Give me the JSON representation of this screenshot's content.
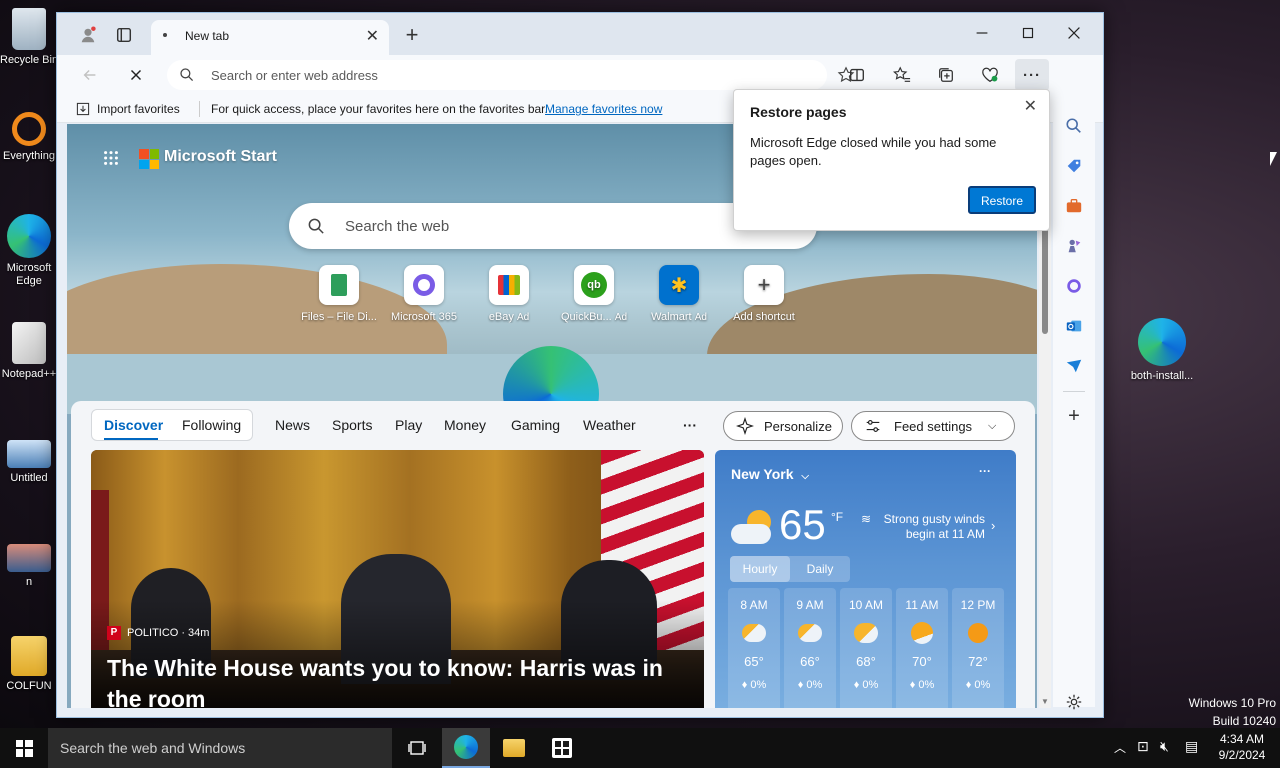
{
  "desktop": {
    "left_icons": [
      {
        "label": "Recycle Bin"
      },
      {
        "label": "Everything"
      },
      {
        "label": "Microsoft Edge"
      },
      {
        "label": "Notepad++"
      },
      {
        "label": "Untitled"
      },
      {
        "label": "n"
      },
      {
        "label": "COLFUN"
      }
    ],
    "right_icon": {
      "label": "both-install..."
    },
    "watermark_line1": "Windows 10 Pro",
    "watermark_line2": "Build 10240"
  },
  "browser": {
    "tab_title": "New tab",
    "address_placeholder": "Search or enter web address",
    "favbar": {
      "import_label": "Import favorites",
      "hint": "For quick access, place your favorites here on the favorites bar.",
      "manage_link": "Manage favorites now"
    },
    "popup": {
      "title": "Restore pages",
      "message": "Microsoft Edge closed while you had some pages open.",
      "button": "Restore"
    }
  },
  "newtab": {
    "brand": "Microsoft Start",
    "search_placeholder": "Search the web",
    "shortcuts": [
      {
        "label": "Files – File Di..."
      },
      {
        "label": "Microsoft 365"
      },
      {
        "label": "eBay",
        "ad": "Ad"
      },
      {
        "label": "QuickBu...",
        "ad": "Ad"
      },
      {
        "label": "Walmart",
        "ad": "Ad"
      },
      {
        "label": "Add shortcut"
      }
    ],
    "nav": {
      "tabs": [
        "Discover",
        "Following"
      ],
      "categories": [
        "News",
        "Sports",
        "Play",
        "Money",
        "Gaming",
        "Weather"
      ],
      "more": "···",
      "personalize": "Personalize",
      "feed_settings": "Feed settings"
    },
    "news": {
      "source": "POLITICO",
      "age": "34m",
      "headline": "The White House wants you to know: Harris was in the room"
    },
    "weather": {
      "location": "New York",
      "temp": "65",
      "unit": "°F",
      "summary_line1": "Strong gusty winds",
      "summary_line2": "begin at 11 AM",
      "tabs": [
        "Hourly",
        "Daily"
      ],
      "hours": [
        {
          "time": "8 AM",
          "temp": "65°",
          "precip": "0%",
          "icon": "partly-cloudy"
        },
        {
          "time": "9 AM",
          "temp": "66°",
          "precip": "0%",
          "icon": "partly-cloudy"
        },
        {
          "time": "10 AM",
          "temp": "68°",
          "precip": "0%",
          "icon": "partly-sunny"
        },
        {
          "time": "11 AM",
          "temp": "70°",
          "precip": "0%",
          "icon": "mostly-sunny"
        },
        {
          "time": "12 PM",
          "temp": "72°",
          "precip": "0%",
          "icon": "sunny"
        }
      ]
    }
  },
  "taskbar": {
    "search_placeholder": "Search the web and Windows",
    "time": "4:34 AM",
    "date": "9/2/2024"
  },
  "colors": {
    "accent": "#0067c0",
    "restore_button": "#0078d4"
  }
}
